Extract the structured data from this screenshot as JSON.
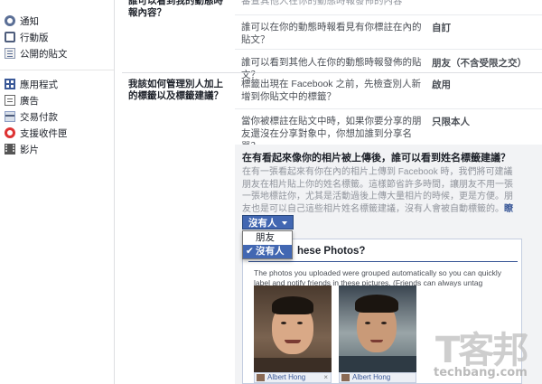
{
  "sidebar": {
    "group1": [
      {
        "label": "通知",
        "icon": "settings-icon"
      },
      {
        "label": "行動版",
        "icon": "mobile-icon"
      },
      {
        "label": "公開的貼文",
        "icon": "public-posts-icon"
      }
    ],
    "group2": [
      {
        "label": "應用程式",
        "icon": "apps-icon"
      },
      {
        "label": "廣告",
        "icon": "ads-icon"
      },
      {
        "label": "交易付款",
        "icon": "payments-icon"
      },
      {
        "label": "支援收件匣",
        "icon": "support-inbox-icon"
      },
      {
        "label": "影片",
        "icon": "video-icon"
      }
    ]
  },
  "timeline_section": {
    "label": "誰可以看到我的動態時報內容？",
    "top_partial_text": "審查其他人在你的動態時報發佈的內容",
    "rows": [
      {
        "question": "誰可以在你的動態時報看見有你標註在內的貼文？",
        "value": "自訂"
      },
      {
        "question": "誰可以看到其他人在你的動態時報發佈的貼文？",
        "value": "朋友（不含受限之交）"
      }
    ]
  },
  "tagging_section": {
    "label": "我該如何管理別人加上的標籤以及標籤建議？",
    "rows": [
      {
        "question": "標籤出現在 Facebook 之前，先檢查別人新增到你貼文中的標籤？",
        "value": "啟用"
      },
      {
        "question": "當你被標註在貼文中時，如果你要分享的朋友還沒在分享對象中，你想加誰到分享名單？",
        "value": "只限本人"
      }
    ]
  },
  "panel": {
    "title": "在有看起來像你的相片被上傳後，誰可以看到姓名標籤建議？",
    "description": "在有一張看起來有你在內的相片上傳到 Facebook 時，我們將可建議朋友在相片貼上你的姓名標籤。這樣節省許多時間，讓朋友不用一張一張地標註你，尤其是活動過後上傳大量相片的時候，更是方便。朋友也是可以自己這些相片姓名標籤建議，沒有人會被自動標籤的。",
    "learn_more": "瞭解更多。",
    "dropdown": {
      "selected": "沒有人",
      "options": [
        "朋友",
        "沒有人"
      ]
    }
  },
  "sample_card": {
    "title": "hese Photos?",
    "description": "The photos you uploaded were grouped automatically so you can quickly label and notify friends in these pictures. (Friends can always untag themselves.)",
    "tags": [
      "Albert Hong",
      "Albert Hong"
    ]
  },
  "watermark": {
    "big": "T客邦",
    "small": "techbang.com"
  },
  "colors": {
    "facebook_blue": "#4267b2",
    "link_blue": "#3b5998",
    "panel_bg": "#f2f3f5"
  }
}
